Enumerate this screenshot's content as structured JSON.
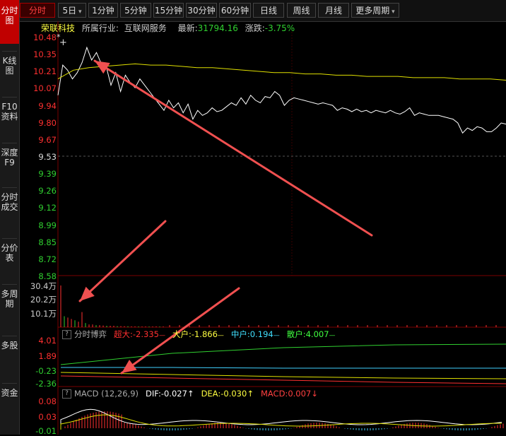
{
  "sidebar": {
    "tabs": [
      {
        "label": "分时图",
        "active": true
      },
      {
        "label": "K线图",
        "active": false
      },
      {
        "label": "F10资料",
        "active": false
      },
      {
        "label": "深度F9",
        "active": false
      },
      {
        "label": "分时成交",
        "active": false
      },
      {
        "label": "分价表",
        "active": false
      },
      {
        "label": "多周期",
        "active": false
      },
      {
        "label": "多股",
        "active": false
      },
      {
        "label": "资金",
        "active": false
      }
    ]
  },
  "toolbar": {
    "buttons": [
      {
        "label": "分时",
        "active": true
      },
      {
        "label": "5日",
        "dropdown": true
      },
      {
        "label": "1分钟"
      },
      {
        "label": "5分钟"
      },
      {
        "label": "15分钟"
      },
      {
        "label": "30分钟"
      },
      {
        "label": "60分钟"
      },
      {
        "label": "日线"
      },
      {
        "label": "周线"
      },
      {
        "label": "月线"
      },
      {
        "label": "更多周期",
        "dropdown": true
      }
    ]
  },
  "stock": {
    "name": "荣联科技",
    "industry_label": "所属行业:",
    "industry": "互联网服务",
    "latest_label": "最新:",
    "latest": "31794.16",
    "change_label": "涨跌:",
    "change": "-3.75%"
  },
  "price_axis": {
    "labels": [
      {
        "v": "10.48",
        "c": "red"
      },
      {
        "v": "10.35",
        "c": "red"
      },
      {
        "v": "10.21",
        "c": "red"
      },
      {
        "v": "10.07",
        "c": "red"
      },
      {
        "v": "9.94",
        "c": "red"
      },
      {
        "v": "9.80",
        "c": "red"
      },
      {
        "v": "9.67",
        "c": "red"
      },
      {
        "v": "9.53",
        "c": "white"
      },
      {
        "v": "9.39",
        "c": "green"
      },
      {
        "v": "9.26",
        "c": "green"
      },
      {
        "v": "9.12",
        "c": "green"
      },
      {
        "v": "8.99",
        "c": "green"
      },
      {
        "v": "8.85",
        "c": "green"
      },
      {
        "v": "8.72",
        "c": "green"
      },
      {
        "v": "8.58",
        "c": "green"
      }
    ]
  },
  "volume_axis": {
    "labels": [
      "30.4万",
      "20.2万",
      "10.1万"
    ]
  },
  "game_panel": {
    "title": "分时博弈",
    "items": [
      {
        "label": "超大:",
        "value": "-2.335",
        "color": "#ff3030"
      },
      {
        "label": "大户:",
        "value": "-1.866",
        "color": "#ffff40"
      },
      {
        "label": "中户:",
        "value": "0.194",
        "color": "#40e0ff"
      },
      {
        "label": "散户:",
        "value": "4.007",
        "color": "#40ff40"
      }
    ],
    "axis": [
      {
        "v": "4.01",
        "c": "red"
      },
      {
        "v": "1.89",
        "c": "red"
      },
      {
        "v": "-0.23",
        "c": "green"
      },
      {
        "v": "-2.36",
        "c": "green"
      }
    ]
  },
  "macd_panel": {
    "title": "MACD (12,26,9)",
    "items": [
      {
        "label": "DIF:",
        "value": "-0.027",
        "arrow": "↑",
        "color": "#ffffff"
      },
      {
        "label": "DEA:",
        "value": "-0.030",
        "arrow": "↑",
        "color": "#ffff40"
      },
      {
        "label": "MACD:",
        "value": "0.007",
        "arrow": "↓",
        "color": "#ff4040"
      }
    ],
    "axis": [
      {
        "v": "0.08",
        "c": "red"
      },
      {
        "v": "0.03",
        "c": "red"
      },
      {
        "v": "-0.01",
        "c": "green"
      }
    ]
  },
  "colors": {
    "up": "#ff3030",
    "down": "#30d030",
    "flat": "#dddddd",
    "accent": "#c00000"
  },
  "chart_data": {
    "type": "line",
    "series": [
      {
        "values": [
          10.02,
          10.26,
          10.22,
          10.15,
          10.2,
          10.28,
          10.4,
          10.3,
          10.36,
          10.27,
          10.25,
          10.1,
          10.2,
          10.05,
          10.18,
          10.12,
          10.08,
          10.15,
          10.1,
          10.05,
          10.0,
          9.95,
          9.9,
          9.98,
          9.92,
          9.96,
          9.88,
          9.95,
          9.83,
          9.9,
          9.86,
          9.88,
          9.92,
          9.89,
          9.9,
          9.93,
          9.96,
          9.94,
          10.0,
          9.95,
          10.02,
          9.98,
          9.96,
          10.01,
          10.0,
          10.05,
          10.02,
          9.94,
          9.98,
          10.0,
          9.99,
          9.98,
          9.97,
          9.96,
          9.95,
          9.96,
          9.95,
          9.94,
          9.9,
          9.92,
          9.91,
          9.89,
          9.91,
          9.89,
          9.9,
          9.88,
          9.9,
          9.89,
          9.88,
          9.9,
          9.88,
          9.87,
          9.89,
          9.92,
          9.86,
          9.88,
          9.87,
          9.86,
          9.86,
          9.86,
          9.85,
          9.84,
          9.83,
          9.8,
          9.72,
          9.76,
          9.74,
          9.77,
          9.76,
          9.73,
          9.73,
          9.76,
          9.8,
          9.79
        ]
      },
      {
        "values": [
          10.15,
          10.22,
          10.24,
          10.25,
          10.26,
          10.27,
          10.26,
          10.26,
          10.25,
          10.24,
          10.24,
          10.23,
          10.22,
          10.21,
          10.2,
          10.2,
          10.19,
          10.19,
          10.18,
          10.18,
          10.17,
          10.17,
          10.17,
          10.16,
          10.16,
          10.16,
          10.15,
          10.15,
          10.15,
          10.14
        ]
      }
    ],
    "volume": [
      30.4,
      8,
      7,
      6,
      5,
      4,
      11,
      3,
      2,
      2,
      1.5,
      1.5,
      1.2,
      1,
      1,
      1,
      0.8,
      0.8,
      0.7,
      0.7,
      0.6,
      0.6,
      0.6,
      0.5,
      0.5,
      0.5,
      0.5,
      0.6,
      0.5,
      0.5
    ],
    "ylim": [
      8.58,
      10.48
    ]
  }
}
